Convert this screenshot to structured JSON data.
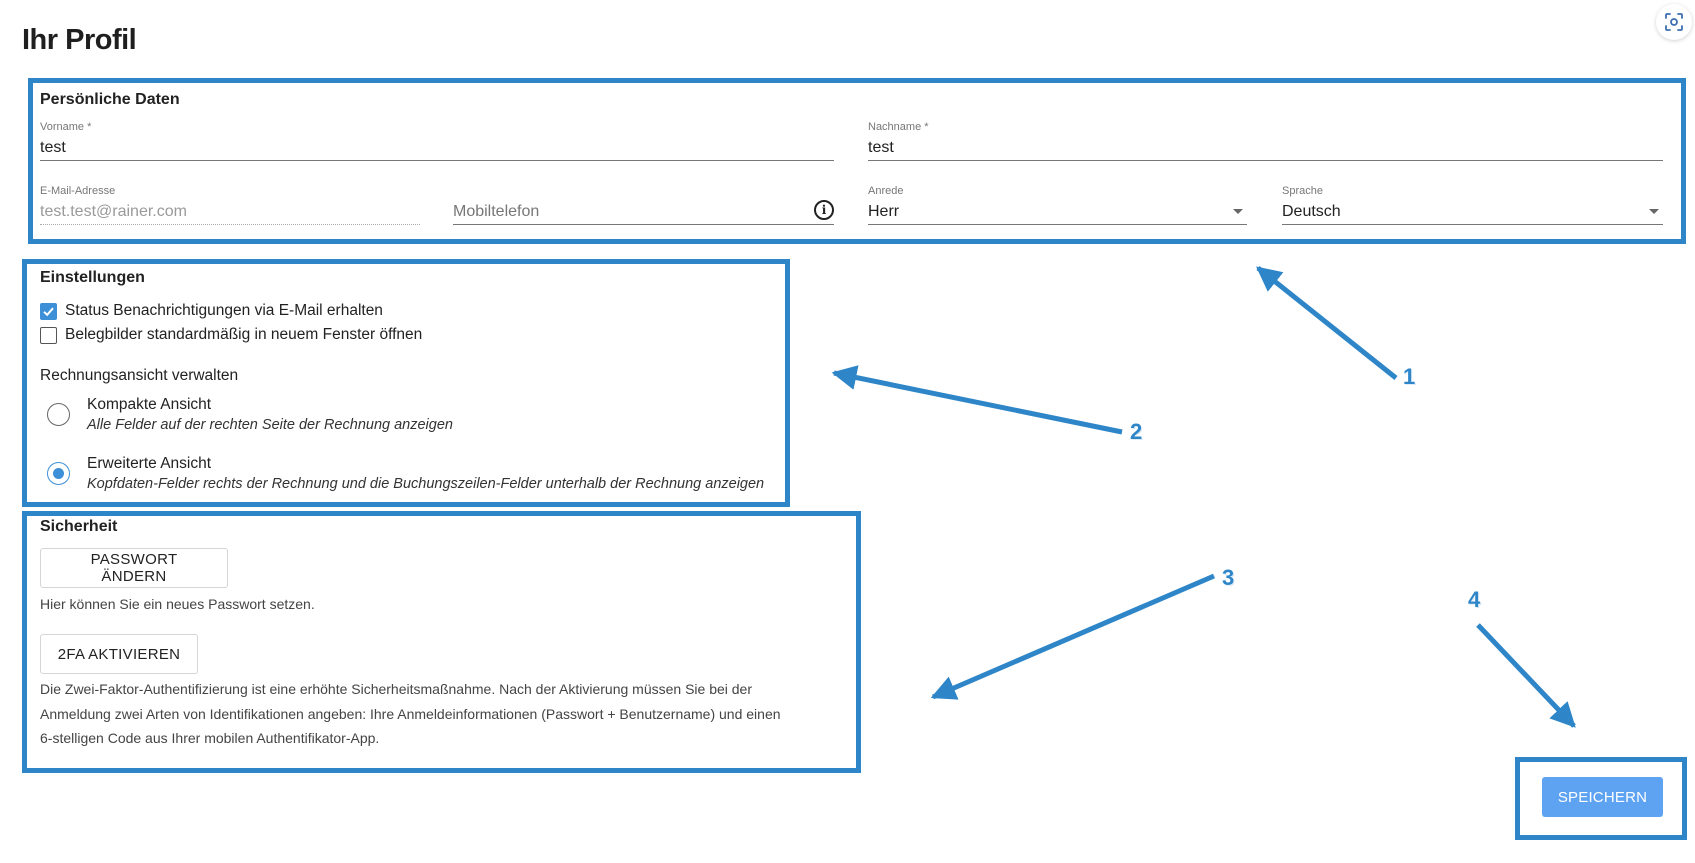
{
  "header": {
    "title": "Ihr Profil",
    "screenshot_icon": "capture-icon"
  },
  "personal": {
    "title": "Persönliche Daten",
    "first_name": {
      "label": "Vorname *",
      "value": "test"
    },
    "last_name": {
      "label": "Nachname *",
      "value": "test"
    },
    "email": {
      "label": "E-Mail-Adresse",
      "value": "test.test@rainer.com"
    },
    "mobile": {
      "placeholder": "Mobiltelefon",
      "icon": "info-icon"
    },
    "salutation": {
      "label": "Anrede",
      "value": "Herr"
    },
    "language": {
      "label": "Sprache",
      "value": "Deutsch"
    }
  },
  "settings": {
    "title": "Einstellungen",
    "checkbox_status": {
      "label": "Status Benachrichtigungen via E-Mail erhalten",
      "checked": true
    },
    "checkbox_new_window": {
      "label": "Belegbilder standardmäßig in neuem Fenster öffnen",
      "checked": false
    },
    "invoice_view_title": "Rechnungsansicht verwalten",
    "compact": {
      "title": "Kompakte Ansicht",
      "desc": "Alle Felder auf der rechten Seite der Rechnung anzeigen",
      "selected": false
    },
    "extended": {
      "title": "Erweiterte Ansicht",
      "desc": "Kopfdaten-Felder rechts der Rechnung und die Buchungszeilen-Felder unterhalb der Rechnung anzeigen",
      "selected": true
    }
  },
  "security": {
    "title": "Sicherheit",
    "change_password_label": "PASSWORT ÄNDERN",
    "change_password_help": "Hier können Sie ein neues Passwort setzen.",
    "twofa_label": "2FA AKTIVIEREN",
    "twofa_help_1": "Die Zwei-Faktor-Authentifizierung ist eine erhöhte Sicherheitsmaßnahme. Nach der Aktivierung müssen Sie bei der",
    "twofa_help_2": "Anmeldung zwei Arten von Identifikationen angeben: Ihre Anmeldeinformationen (Passwort + Benutzername) und einen",
    "twofa_help_3": "6-stelligen Code aus Ihrer mobilen Authentifikator-App."
  },
  "save_label": "SPEICHERN",
  "annotations": {
    "n1": "1",
    "n2": "2",
    "n3": "3",
    "n4": "4"
  },
  "colors": {
    "annotation": "#2e86c8",
    "accent": "#3d8fd8",
    "primary_button": "#5ea3f2"
  }
}
